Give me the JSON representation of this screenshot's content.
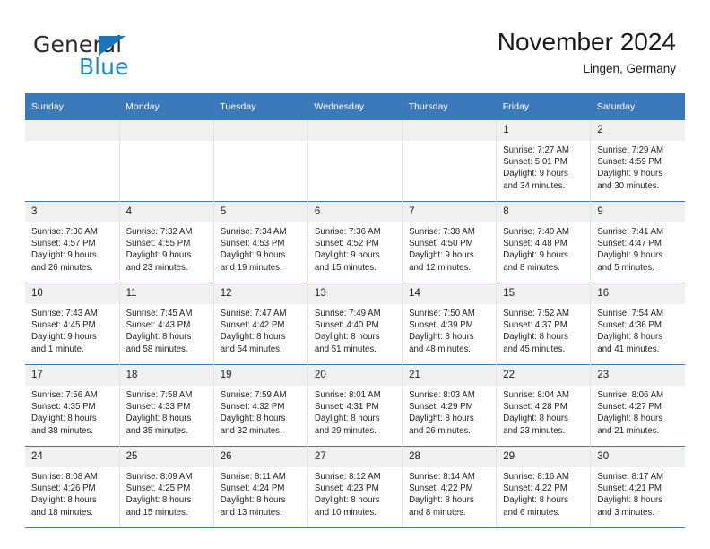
{
  "brand": {
    "name_top": "General",
    "name_bottom": "Blue",
    "triangle_color": "#1b75bc",
    "blue_color": "#1b8ad6"
  },
  "header": {
    "title": "November 2024",
    "subtitle": "Lingen, Germany"
  },
  "theme": {
    "header_blue": "#3b79ba",
    "daynum_band": "#f0f0f0",
    "text": "#1f1f1f"
  },
  "weekdays": [
    "Sunday",
    "Monday",
    "Tuesday",
    "Wednesday",
    "Thursday",
    "Friday",
    "Saturday"
  ],
  "labels": {
    "sunrise_prefix": "Sunrise:",
    "sunset_prefix": "Sunset:",
    "daylight_prefix": "Daylight:"
  },
  "weeks": [
    [
      {
        "day": "",
        "blank": true
      },
      {
        "day": "",
        "blank": true
      },
      {
        "day": "",
        "blank": true
      },
      {
        "day": "",
        "blank": true
      },
      {
        "day": "",
        "blank": true
      },
      {
        "day": "1",
        "sunrise": "Sunrise: 7:27 AM",
        "sunset": "Sunset: 5:01 PM",
        "daylight_1": "Daylight: 9 hours",
        "daylight_2": "and 34 minutes."
      },
      {
        "day": "2",
        "sunrise": "Sunrise: 7:29 AM",
        "sunset": "Sunset: 4:59 PM",
        "daylight_1": "Daylight: 9 hours",
        "daylight_2": "and 30 minutes."
      }
    ],
    [
      {
        "day": "3",
        "sunrise": "Sunrise: 7:30 AM",
        "sunset": "Sunset: 4:57 PM",
        "daylight_1": "Daylight: 9 hours",
        "daylight_2": "and 26 minutes."
      },
      {
        "day": "4",
        "sunrise": "Sunrise: 7:32 AM",
        "sunset": "Sunset: 4:55 PM",
        "daylight_1": "Daylight: 9 hours",
        "daylight_2": "and 23 minutes."
      },
      {
        "day": "5",
        "sunrise": "Sunrise: 7:34 AM",
        "sunset": "Sunset: 4:53 PM",
        "daylight_1": "Daylight: 9 hours",
        "daylight_2": "and 19 minutes."
      },
      {
        "day": "6",
        "sunrise": "Sunrise: 7:36 AM",
        "sunset": "Sunset: 4:52 PM",
        "daylight_1": "Daylight: 9 hours",
        "daylight_2": "and 15 minutes."
      },
      {
        "day": "7",
        "sunrise": "Sunrise: 7:38 AM",
        "sunset": "Sunset: 4:50 PM",
        "daylight_1": "Daylight: 9 hours",
        "daylight_2": "and 12 minutes."
      },
      {
        "day": "8",
        "sunrise": "Sunrise: 7:40 AM",
        "sunset": "Sunset: 4:48 PM",
        "daylight_1": "Daylight: 9 hours",
        "daylight_2": "and 8 minutes."
      },
      {
        "day": "9",
        "sunrise": "Sunrise: 7:41 AM",
        "sunset": "Sunset: 4:47 PM",
        "daylight_1": "Daylight: 9 hours",
        "daylight_2": "and 5 minutes."
      }
    ],
    [
      {
        "day": "10",
        "sunrise": "Sunrise: 7:43 AM",
        "sunset": "Sunset: 4:45 PM",
        "daylight_1": "Daylight: 9 hours",
        "daylight_2": "and 1 minute."
      },
      {
        "day": "11",
        "sunrise": "Sunrise: 7:45 AM",
        "sunset": "Sunset: 4:43 PM",
        "daylight_1": "Daylight: 8 hours",
        "daylight_2": "and 58 minutes."
      },
      {
        "day": "12",
        "sunrise": "Sunrise: 7:47 AM",
        "sunset": "Sunset: 4:42 PM",
        "daylight_1": "Daylight: 8 hours",
        "daylight_2": "and 54 minutes."
      },
      {
        "day": "13",
        "sunrise": "Sunrise: 7:49 AM",
        "sunset": "Sunset: 4:40 PM",
        "daylight_1": "Daylight: 8 hours",
        "daylight_2": "and 51 minutes."
      },
      {
        "day": "14",
        "sunrise": "Sunrise: 7:50 AM",
        "sunset": "Sunset: 4:39 PM",
        "daylight_1": "Daylight: 8 hours",
        "daylight_2": "and 48 minutes."
      },
      {
        "day": "15",
        "sunrise": "Sunrise: 7:52 AM",
        "sunset": "Sunset: 4:37 PM",
        "daylight_1": "Daylight: 8 hours",
        "daylight_2": "and 45 minutes."
      },
      {
        "day": "16",
        "sunrise": "Sunrise: 7:54 AM",
        "sunset": "Sunset: 4:36 PM",
        "daylight_1": "Daylight: 8 hours",
        "daylight_2": "and 41 minutes."
      }
    ],
    [
      {
        "day": "17",
        "sunrise": "Sunrise: 7:56 AM",
        "sunset": "Sunset: 4:35 PM",
        "daylight_1": "Daylight: 8 hours",
        "daylight_2": "and 38 minutes."
      },
      {
        "day": "18",
        "sunrise": "Sunrise: 7:58 AM",
        "sunset": "Sunset: 4:33 PM",
        "daylight_1": "Daylight: 8 hours",
        "daylight_2": "and 35 minutes."
      },
      {
        "day": "19",
        "sunrise": "Sunrise: 7:59 AM",
        "sunset": "Sunset: 4:32 PM",
        "daylight_1": "Daylight: 8 hours",
        "daylight_2": "and 32 minutes."
      },
      {
        "day": "20",
        "sunrise": "Sunrise: 8:01 AM",
        "sunset": "Sunset: 4:31 PM",
        "daylight_1": "Daylight: 8 hours",
        "daylight_2": "and 29 minutes."
      },
      {
        "day": "21",
        "sunrise": "Sunrise: 8:03 AM",
        "sunset": "Sunset: 4:29 PM",
        "daylight_1": "Daylight: 8 hours",
        "daylight_2": "and 26 minutes."
      },
      {
        "day": "22",
        "sunrise": "Sunrise: 8:04 AM",
        "sunset": "Sunset: 4:28 PM",
        "daylight_1": "Daylight: 8 hours",
        "daylight_2": "and 23 minutes."
      },
      {
        "day": "23",
        "sunrise": "Sunrise: 8:06 AM",
        "sunset": "Sunset: 4:27 PM",
        "daylight_1": "Daylight: 8 hours",
        "daylight_2": "and 21 minutes."
      }
    ],
    [
      {
        "day": "24",
        "sunrise": "Sunrise: 8:08 AM",
        "sunset": "Sunset: 4:26 PM",
        "daylight_1": "Daylight: 8 hours",
        "daylight_2": "and 18 minutes."
      },
      {
        "day": "25",
        "sunrise": "Sunrise: 8:09 AM",
        "sunset": "Sunset: 4:25 PM",
        "daylight_1": "Daylight: 8 hours",
        "daylight_2": "and 15 minutes."
      },
      {
        "day": "26",
        "sunrise": "Sunrise: 8:11 AM",
        "sunset": "Sunset: 4:24 PM",
        "daylight_1": "Daylight: 8 hours",
        "daylight_2": "and 13 minutes."
      },
      {
        "day": "27",
        "sunrise": "Sunrise: 8:12 AM",
        "sunset": "Sunset: 4:23 PM",
        "daylight_1": "Daylight: 8 hours",
        "daylight_2": "and 10 minutes."
      },
      {
        "day": "28",
        "sunrise": "Sunrise: 8:14 AM",
        "sunset": "Sunset: 4:22 PM",
        "daylight_1": "Daylight: 8 hours",
        "daylight_2": "and 8 minutes."
      },
      {
        "day": "29",
        "sunrise": "Sunrise: 8:16 AM",
        "sunset": "Sunset: 4:22 PM",
        "daylight_1": "Daylight: 8 hours",
        "daylight_2": "and 6 minutes."
      },
      {
        "day": "30",
        "sunrise": "Sunrise: 8:17 AM",
        "sunset": "Sunset: 4:21 PM",
        "daylight_1": "Daylight: 8 hours",
        "daylight_2": "and 3 minutes."
      }
    ]
  ]
}
